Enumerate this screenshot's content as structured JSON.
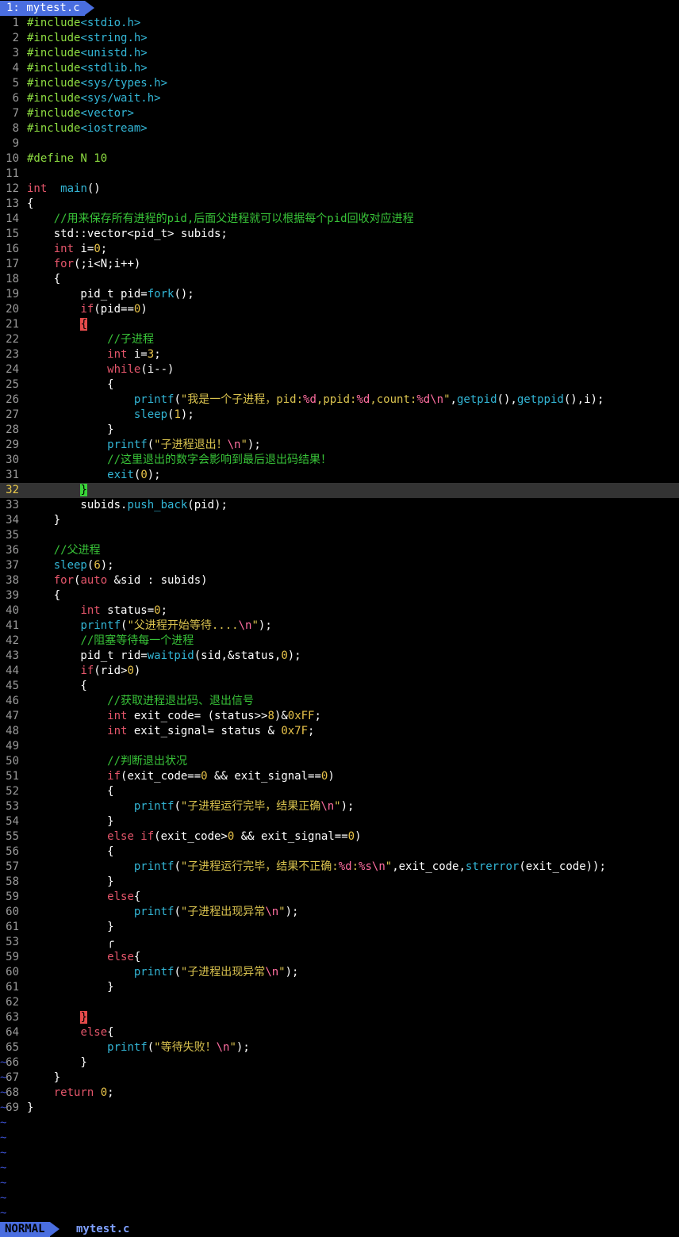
{
  "tab": {
    "label": "1: mytest.c"
  },
  "status": {
    "mode": "NORMAL",
    "file": "mytest.c"
  },
  "cursor_line": 32,
  "tilde_char": "~",
  "tilde_count": 11,
  "colors": {
    "background": "#000000",
    "accent": "#4a6ee0",
    "keyword": "#e5566b",
    "function": "#33b6d6",
    "string": "#d9c24e",
    "preproc": "#8ddc41",
    "comment": "#38c338",
    "number": "#e8c34a",
    "escape": "#ff6ea0"
  },
  "lines": [
    {
      "n": "1",
      "t": [
        [
          "pp",
          "#include"
        ],
        [
          "f",
          "<stdio.h>"
        ]
      ]
    },
    {
      "n": "2",
      "t": [
        [
          "pp",
          "#include"
        ],
        [
          "f",
          "<string.h>"
        ]
      ]
    },
    {
      "n": "3",
      "t": [
        [
          "pp",
          "#include"
        ],
        [
          "f",
          "<unistd.h>"
        ]
      ]
    },
    {
      "n": "4",
      "t": [
        [
          "pp",
          "#include"
        ],
        [
          "f",
          "<stdlib.h>"
        ]
      ]
    },
    {
      "n": "5",
      "t": [
        [
          "pp",
          "#include"
        ],
        [
          "f",
          "<sys/types.h>"
        ]
      ]
    },
    {
      "n": "6",
      "t": [
        [
          "pp",
          "#include"
        ],
        [
          "f",
          "<sys/wait.h>"
        ]
      ]
    },
    {
      "n": "7",
      "t": [
        [
          "pp",
          "#include"
        ],
        [
          "f",
          "<vector>"
        ]
      ]
    },
    {
      "n": "8",
      "t": [
        [
          "pp",
          "#include"
        ],
        [
          "f",
          "<iostream>"
        ]
      ]
    },
    {
      "n": "9",
      "t": []
    },
    {
      "n": "10",
      "t": [
        [
          "pp",
          "#define N 10"
        ]
      ]
    },
    {
      "n": "11",
      "t": []
    },
    {
      "n": "12",
      "t": [
        [
          "k",
          "int"
        ],
        [
          "",
          "  "
        ],
        [
          "f",
          "main"
        ],
        [
          "",
          "()"
        ]
      ]
    },
    {
      "n": "13",
      "t": [
        [
          "",
          "{"
        ]
      ]
    },
    {
      "n": "14",
      "t": [
        [
          "",
          "    "
        ],
        [
          "cm",
          "//用来保存所有进程的pid,后面父进程就可以根据每个pid回收对应进程"
        ]
      ]
    },
    {
      "n": "15",
      "t": [
        [
          "",
          "    std::vector<pid_t> subids;"
        ]
      ]
    },
    {
      "n": "16",
      "t": [
        [
          "",
          "    "
        ],
        [
          "k",
          "int"
        ],
        [
          "",
          " i="
        ],
        [
          "n",
          "0"
        ],
        [
          "",
          ";"
        ]
      ]
    },
    {
      "n": "17",
      "t": [
        [
          "",
          "    "
        ],
        [
          "k",
          "for"
        ],
        [
          "",
          "(;i<N;i++)"
        ]
      ]
    },
    {
      "n": "18",
      "t": [
        [
          "",
          "    {"
        ]
      ]
    },
    {
      "n": "19",
      "t": [
        [
          "",
          "        pid_t pid="
        ],
        [
          "f",
          "fork"
        ],
        [
          "",
          "();"
        ]
      ]
    },
    {
      "n": "20",
      "t": [
        [
          "",
          "        "
        ],
        [
          "k",
          "if"
        ],
        [
          "",
          "(pid=="
        ],
        [
          "n",
          "0"
        ],
        [
          "",
          ")"
        ]
      ]
    },
    {
      "n": "21",
      "t": [
        [
          "",
          "        "
        ],
        [
          "br",
          "{"
        ]
      ]
    },
    {
      "n": "22",
      "t": [
        [
          "",
          "            "
        ],
        [
          "cm",
          "//子进程"
        ]
      ]
    },
    {
      "n": "23",
      "t": [
        [
          "",
          "            "
        ],
        [
          "k",
          "int"
        ],
        [
          "",
          " i="
        ],
        [
          "n",
          "3"
        ],
        [
          "",
          ";"
        ]
      ]
    },
    {
      "n": "24",
      "t": [
        [
          "",
          "            "
        ],
        [
          "k",
          "while"
        ],
        [
          "",
          "(i--)"
        ]
      ]
    },
    {
      "n": "25",
      "t": [
        [
          "",
          "            {"
        ]
      ]
    },
    {
      "n": "26",
      "t": [
        [
          "",
          "                "
        ],
        [
          "f",
          "printf"
        ],
        [
          "",
          "("
        ],
        [
          "s",
          "\"我是一个子进程，pid:"
        ],
        [
          "e",
          "%d"
        ],
        [
          "s",
          ",ppid:"
        ],
        [
          "e",
          "%d"
        ],
        [
          "s",
          ",count:"
        ],
        [
          "e",
          "%d\\n"
        ],
        [
          "s",
          "\""
        ],
        [
          "",
          ","
        ],
        [
          "f",
          "getpid"
        ],
        [
          "",
          "(),"
        ],
        [
          "f",
          "getppid"
        ],
        [
          "",
          "(),i);"
        ]
      ]
    },
    {
      "n": "27",
      "t": [
        [
          "",
          "                "
        ],
        [
          "f",
          "sleep"
        ],
        [
          "",
          "("
        ],
        [
          "n",
          "1"
        ],
        [
          "",
          "); "
        ]
      ]
    },
    {
      "n": "28",
      "t": [
        [
          "",
          "            }"
        ]
      ]
    },
    {
      "n": "29",
      "t": [
        [
          "",
          "            "
        ],
        [
          "f",
          "printf"
        ],
        [
          "",
          "("
        ],
        [
          "s",
          "\"子进程退出！"
        ],
        [
          "e",
          "\\n"
        ],
        [
          "s",
          "\""
        ],
        [
          "",
          ");"
        ]
      ]
    },
    {
      "n": "30",
      "t": [
        [
          "",
          "            "
        ],
        [
          "cm",
          "//这里退出的数字会影响到最后退出码结果！"
        ]
      ]
    },
    {
      "n": "31",
      "t": [
        [
          "",
          "            "
        ],
        [
          "f",
          "exit"
        ],
        [
          "",
          "("
        ],
        [
          "n",
          "0"
        ],
        [
          "",
          ");"
        ]
      ]
    },
    {
      "n": "32",
      "t": [
        [
          "",
          "        "
        ],
        [
          "bg",
          "}"
        ]
      ]
    },
    {
      "n": "33",
      "t": [
        [
          "",
          "        subids."
        ],
        [
          "f",
          "push_back"
        ],
        [
          "",
          "(pid);"
        ]
      ]
    },
    {
      "n": "34",
      "t": [
        [
          "",
          "    }"
        ]
      ]
    },
    {
      "n": "35",
      "t": []
    },
    {
      "n": "36",
      "t": [
        [
          "",
          "    "
        ],
        [
          "cm",
          "//父进程"
        ]
      ]
    },
    {
      "n": "37",
      "t": [
        [
          "",
          "    "
        ],
        [
          "f",
          "sleep"
        ],
        [
          "",
          "("
        ],
        [
          "n",
          "6"
        ],
        [
          "",
          ");"
        ]
      ]
    },
    {
      "n": "38",
      "t": [
        [
          "",
          "    "
        ],
        [
          "k",
          "for"
        ],
        [
          "",
          "("
        ],
        [
          "k",
          "auto"
        ],
        [
          "",
          " &sid : subids)"
        ]
      ]
    },
    {
      "n": "39",
      "t": [
        [
          "",
          "    {"
        ]
      ]
    },
    {
      "n": "40",
      "t": [
        [
          "",
          "        "
        ],
        [
          "k",
          "int"
        ],
        [
          "",
          " status="
        ],
        [
          "n",
          "0"
        ],
        [
          "",
          ";"
        ]
      ]
    },
    {
      "n": "41",
      "t": [
        [
          "",
          "        "
        ],
        [
          "f",
          "printf"
        ],
        [
          "",
          "("
        ],
        [
          "s",
          "\"父进程开始等待...."
        ],
        [
          "e",
          "\\n"
        ],
        [
          "s",
          "\""
        ],
        [
          "",
          ");"
        ]
      ]
    },
    {
      "n": "42",
      "t": [
        [
          "",
          "        "
        ],
        [
          "cm",
          "//阻塞等待每一个进程"
        ]
      ]
    },
    {
      "n": "43",
      "t": [
        [
          "",
          "        pid_t rid="
        ],
        [
          "f",
          "waitpid"
        ],
        [
          "",
          "(sid,&status,"
        ],
        [
          "n",
          "0"
        ],
        [
          "",
          ");"
        ]
      ]
    },
    {
      "n": "44",
      "t": [
        [
          "",
          "        "
        ],
        [
          "k",
          "if"
        ],
        [
          "",
          "(rid>"
        ],
        [
          "n",
          "0"
        ],
        [
          "",
          ")"
        ]
      ]
    },
    {
      "n": "45",
      "t": [
        [
          "",
          "        {"
        ]
      ]
    },
    {
      "n": "46",
      "t": [
        [
          "",
          "            "
        ],
        [
          "cm",
          "//获取进程退出码、退出信号"
        ]
      ]
    },
    {
      "n": "47",
      "t": [
        [
          "",
          "            "
        ],
        [
          "k",
          "int"
        ],
        [
          "",
          " exit_code= (status>>"
        ],
        [
          "n",
          "8"
        ],
        [
          "",
          ")&"
        ],
        [
          "n",
          "0xFF"
        ],
        [
          "",
          ";"
        ]
      ]
    },
    {
      "n": "48",
      "t": [
        [
          "",
          "            "
        ],
        [
          "k",
          "int"
        ],
        [
          "",
          " exit_signal= status & "
        ],
        [
          "n",
          "0x7F"
        ],
        [
          "",
          ";"
        ]
      ]
    },
    {
      "n": "49",
      "t": []
    },
    {
      "n": "50",
      "t": [
        [
          "",
          "            "
        ],
        [
          "cm",
          "//判断退出状况"
        ]
      ]
    },
    {
      "n": "51",
      "t": [
        [
          "",
          "            "
        ],
        [
          "k",
          "if"
        ],
        [
          "",
          "(exit_code=="
        ],
        [
          "n",
          "0"
        ],
        [
          "",
          " && exit_signal=="
        ],
        [
          "n",
          "0"
        ],
        [
          "",
          ")"
        ]
      ]
    },
    {
      "n": "52",
      "t": [
        [
          "",
          "            {"
        ]
      ]
    },
    {
      "n": "53",
      "t": [
        [
          "",
          "                "
        ],
        [
          "f",
          "printf"
        ],
        [
          "",
          "("
        ],
        [
          "s",
          "\"子进程运行完毕，结果正确"
        ],
        [
          "e",
          "\\n"
        ],
        [
          "s",
          "\""
        ],
        [
          "",
          ");"
        ]
      ]
    },
    {
      "n": "54",
      "t": [
        [
          "",
          "            }"
        ]
      ]
    },
    {
      "n": "55",
      "t": [
        [
          "",
          "            "
        ],
        [
          "k",
          "else if"
        ],
        [
          "",
          "(exit_code>"
        ],
        [
          "n",
          "0"
        ],
        [
          "",
          " && exit_signal=="
        ],
        [
          "n",
          "0"
        ],
        [
          "",
          ")"
        ]
      ]
    },
    {
      "n": "56",
      "t": [
        [
          "",
          "            {"
        ]
      ]
    },
    {
      "n": "57",
      "t": [
        [
          "",
          "                "
        ],
        [
          "f",
          "printf"
        ],
        [
          "",
          "("
        ],
        [
          "s",
          "\"子进程运行完毕，结果不正确:"
        ],
        [
          "e",
          "%d"
        ],
        [
          "s",
          ":"
        ],
        [
          "e",
          "%s\\n"
        ],
        [
          "s",
          "\""
        ],
        [
          "",
          ",exit_code,"
        ],
        [
          "f",
          "strerror"
        ],
        [
          "",
          "(exit_code));"
        ]
      ]
    },
    {
      "n": "58",
      "t": [
        [
          "",
          "            }"
        ]
      ]
    },
    {
      "n": "59",
      "t": [
        [
          "",
          "            "
        ],
        [
          "k",
          "else"
        ],
        [
          "",
          "{"
        ]
      ]
    },
    {
      "n": "60",
      "t": [
        [
          "",
          "                "
        ],
        [
          "f",
          "printf"
        ],
        [
          "",
          "("
        ],
        [
          "s",
          "\"子进程出现异常"
        ],
        [
          "e",
          "\\n"
        ],
        [
          "s",
          "\""
        ],
        [
          "",
          ");"
        ]
      ]
    },
    {
      "n": "61",
      "t": [
        [
          "",
          "            }"
        ]
      ]
    },
    {
      "n": "53",
      "t": [
        [
          "",
          "            ╭"
        ]
      ]
    },
    {
      "n": "59",
      "t": [
        [
          "",
          "            "
        ],
        [
          "k",
          "else"
        ],
        [
          "",
          "{"
        ]
      ]
    },
    {
      "n": "60",
      "t": [
        [
          "",
          "                "
        ],
        [
          "f",
          "printf"
        ],
        [
          "",
          "("
        ],
        [
          "s",
          "\"子进程出现异常"
        ],
        [
          "e",
          "\\n"
        ],
        [
          "s",
          "\""
        ],
        [
          "",
          ");"
        ]
      ]
    },
    {
      "n": "61",
      "t": [
        [
          "",
          "            }"
        ]
      ]
    },
    {
      "n": "62",
      "t": []
    },
    {
      "n": "63",
      "t": [
        [
          "",
          "        "
        ],
        [
          "br",
          "}"
        ]
      ]
    },
    {
      "n": "64",
      "t": [
        [
          "",
          "        "
        ],
        [
          "k",
          "else"
        ],
        [
          "",
          "{"
        ]
      ]
    },
    {
      "n": "65",
      "t": [
        [
          "",
          "            "
        ],
        [
          "f",
          "printf"
        ],
        [
          "",
          "("
        ],
        [
          "s",
          "\"等待失败！"
        ],
        [
          "e",
          "\\n"
        ],
        [
          "s",
          "\""
        ],
        [
          "",
          ");"
        ]
      ]
    },
    {
      "n": "66",
      "t": [
        [
          "",
          "        }"
        ]
      ]
    },
    {
      "n": "67",
      "t": [
        [
          "",
          "    }"
        ]
      ]
    },
    {
      "n": "68",
      "t": [
        [
          "",
          "    "
        ],
        [
          "k",
          "return"
        ],
        [
          "",
          ""
        ],
        [
          "n",
          " 0"
        ],
        [
          "",
          ";"
        ]
      ]
    },
    {
      "n": "69",
      "t": [
        [
          "",
          "}"
        ]
      ]
    }
  ]
}
